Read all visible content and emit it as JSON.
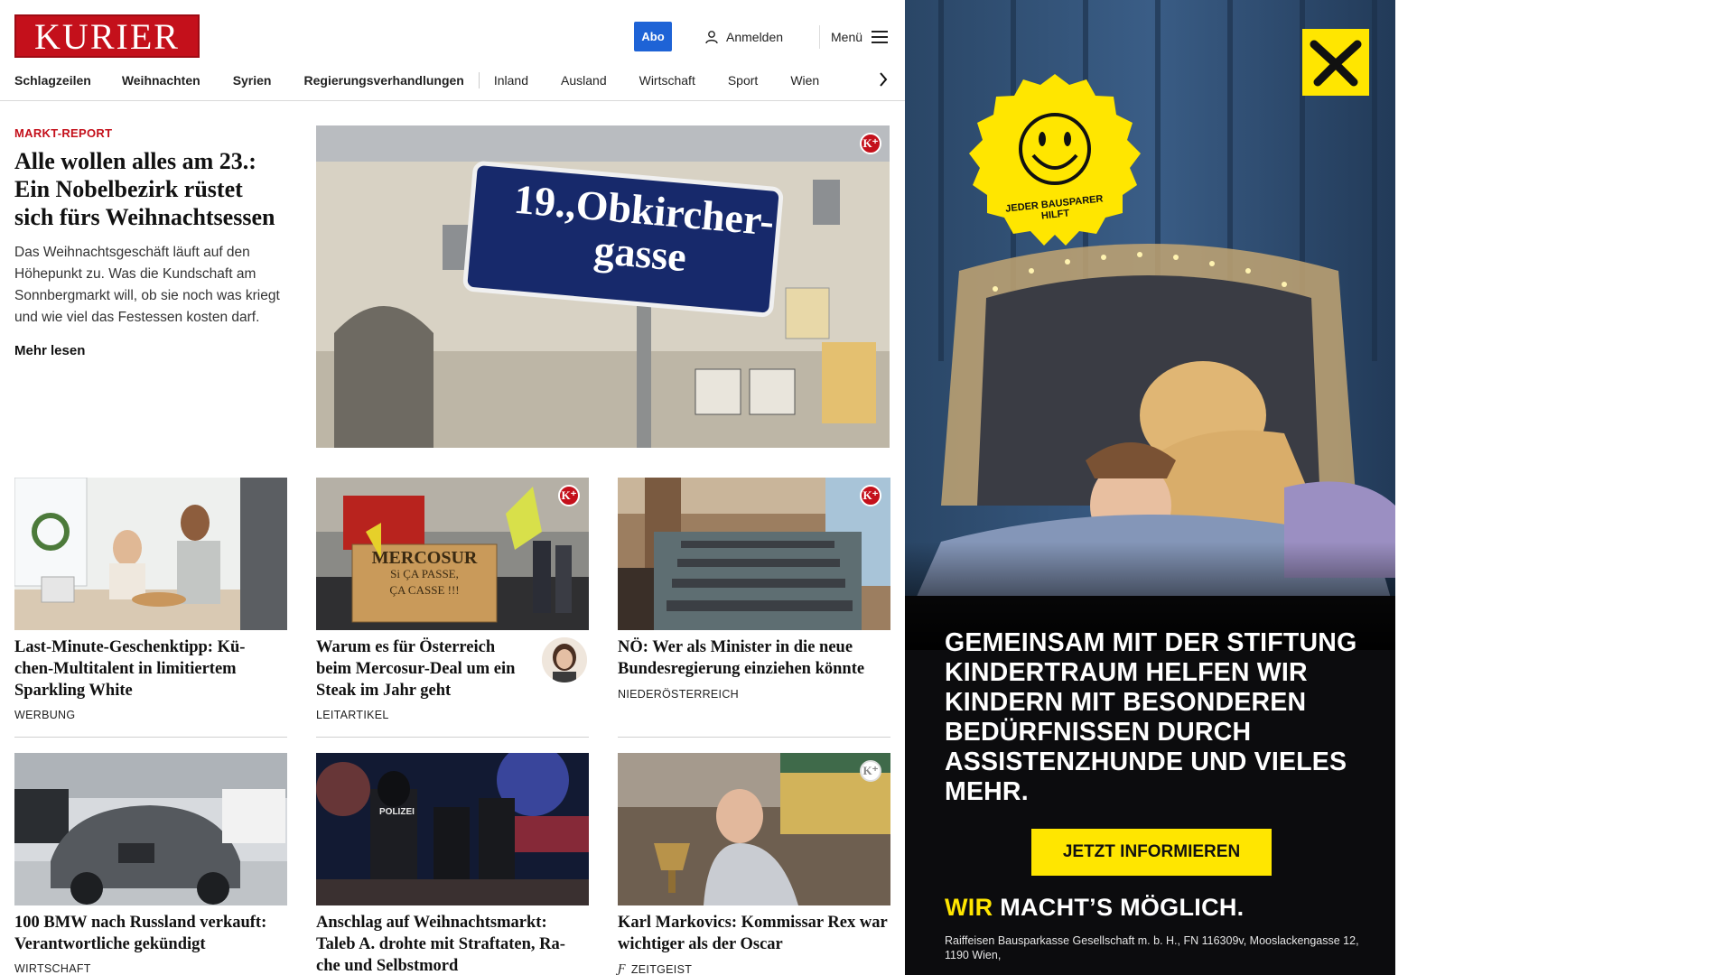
{
  "header": {
    "logo_text": "KURIER",
    "abo_label": "Abo",
    "login_label": "Anmelden",
    "menu_label": "Menü",
    "brand_color": "#c4101b"
  },
  "nav": {
    "items": [
      {
        "label": "Schlagzeilen",
        "bold": true
      },
      {
        "label": "Weihnachten",
        "bold": true
      },
      {
        "label": "Syrien",
        "bold": true
      },
      {
        "label": "Regierungsverhandlungen",
        "bold": true
      },
      {
        "label": "Inland",
        "bold": false
      },
      {
        "label": "Ausland",
        "bold": false
      },
      {
        "label": "Wirtschaft",
        "bold": false
      },
      {
        "label": "Sport",
        "bold": false
      },
      {
        "label": "Wien",
        "bold": false
      }
    ],
    "next_icon": "chevron-right-icon"
  },
  "hero": {
    "kicker": "MARKT-REPORT",
    "title": "Alle wollen alles am 23.: Ein Nobelbezirk rüstet sich fürs Weihnachtsessen",
    "teaser": "Das Weihnachtsgeschäft läuft auf den Höhepunkt zu. Was die Kundschaft am Sonnbergmarkt will, ob sie noch was kriegt und wie viel das Festessen kosten darf.",
    "more": "Mehr lesen",
    "sign_text_1": "19.,Obkircher-",
    "sign_text_2": "gasse",
    "kplus": "K⁺"
  },
  "cards": [
    {
      "title": "Last-Minute-Geschenktipp: Kü-chen-Multitalent in limitiertem Sparkling White",
      "label": "WERBUNG"
    },
    {
      "title": "Warum es für Österreich beim Mercosur-Deal um ein Steak im Jahr geht",
      "label": "LEITARTIKEL",
      "sign_1": "MERCOSUR",
      "sign_2": "Si ÇA PASSE,",
      "sign_3": "ÇA CASSE !!!"
    },
    {
      "title": "NÖ: Wer als Minister in die neue Bundesregierung einziehen könnte",
      "label": "NIEDERÖSTERREICH"
    },
    {
      "title": "100 BMW nach Russland verkauft: Verantwortliche gekündigt",
      "label": "WIRTSCHAFT"
    },
    {
      "title": "Anschlag auf Weihnachtsmarkt: Taleb A. drohte mit Straftaten, Ra-che und Selbstmord",
      "label": "",
      "police_text": "POLIZEI"
    },
    {
      "title": "Karl Markovics: Kommissar Rex war wichtiger als der Oscar",
      "label": "ZEITGEIST"
    }
  ],
  "ad": {
    "badge_text": "JEDER BAUSPARER HILFT",
    "headline": "GEMEINSAM MIT DER STIFTUNG KINDERTRAUM HELFEN WIR KINDERN MIT BESONDEREN BEDÜRFNISSEN DURCH ASSISTENZHUNDE UND VIELES MEHR.",
    "cta": "JETZT INFORMIEREN",
    "slogan_wir": "WIR",
    "slogan_rest": "MACHT’S MÖGLICH.",
    "legal": "Raiffeisen Bausparkasse Gesellschaft m. b. H., FN 116309v, Mooslackengasse 12, 1190 Wien,",
    "accent": "#ffe600"
  }
}
